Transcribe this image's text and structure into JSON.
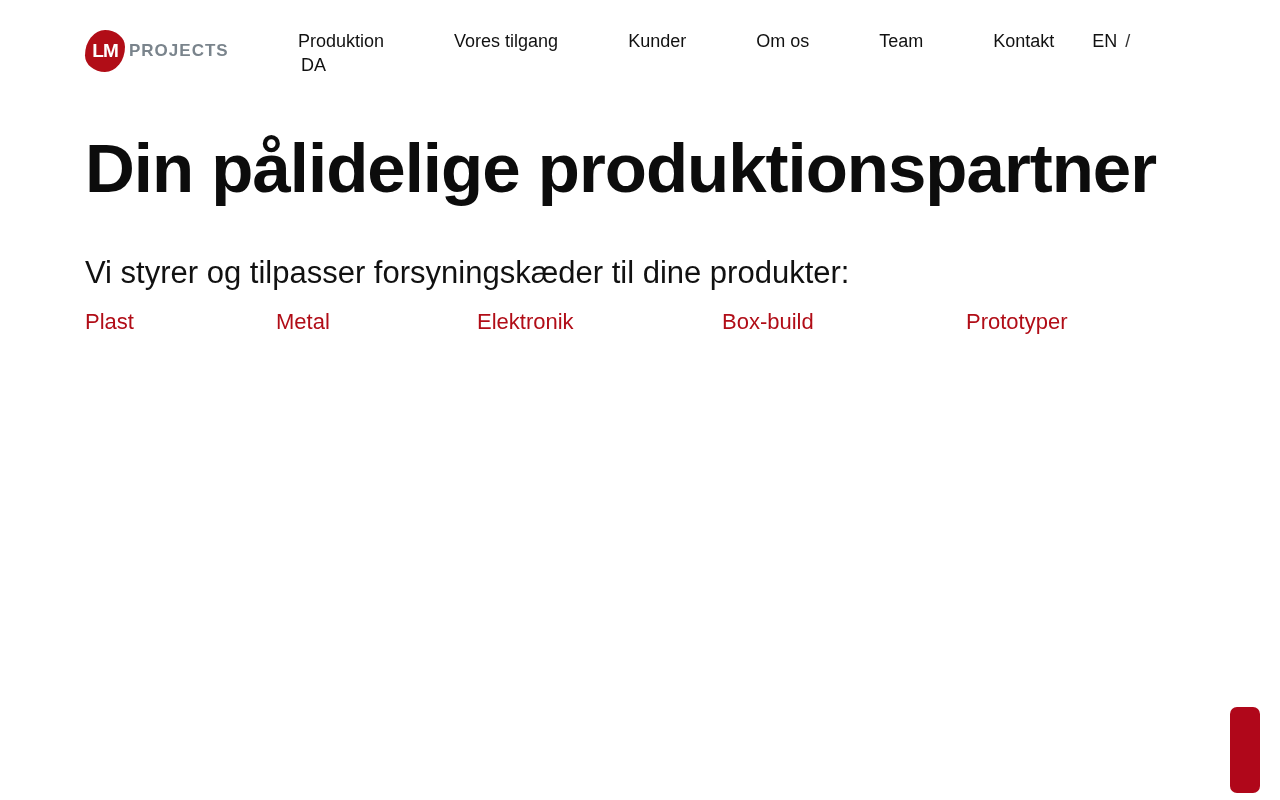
{
  "logo": {
    "mark": "LM",
    "wordmark": "PROJECTS"
  },
  "nav": {
    "items": [
      "Produktion",
      "Vores tilgang",
      "Kunder",
      "Om os",
      "Team",
      "Kontakt"
    ],
    "languages": [
      "EN",
      "DA"
    ],
    "separator": "/"
  },
  "hero": {
    "title": "Din pålidelige produktionspartner",
    "subtitle": "Vi styrer og tilpasser forsyningskæder til dine produkter:",
    "links": [
      "Plast",
      "Metal",
      "Elektronik",
      "Box-build",
      "Prototyper"
    ]
  },
  "side_tab": {
    "kind": "tab"
  }
}
